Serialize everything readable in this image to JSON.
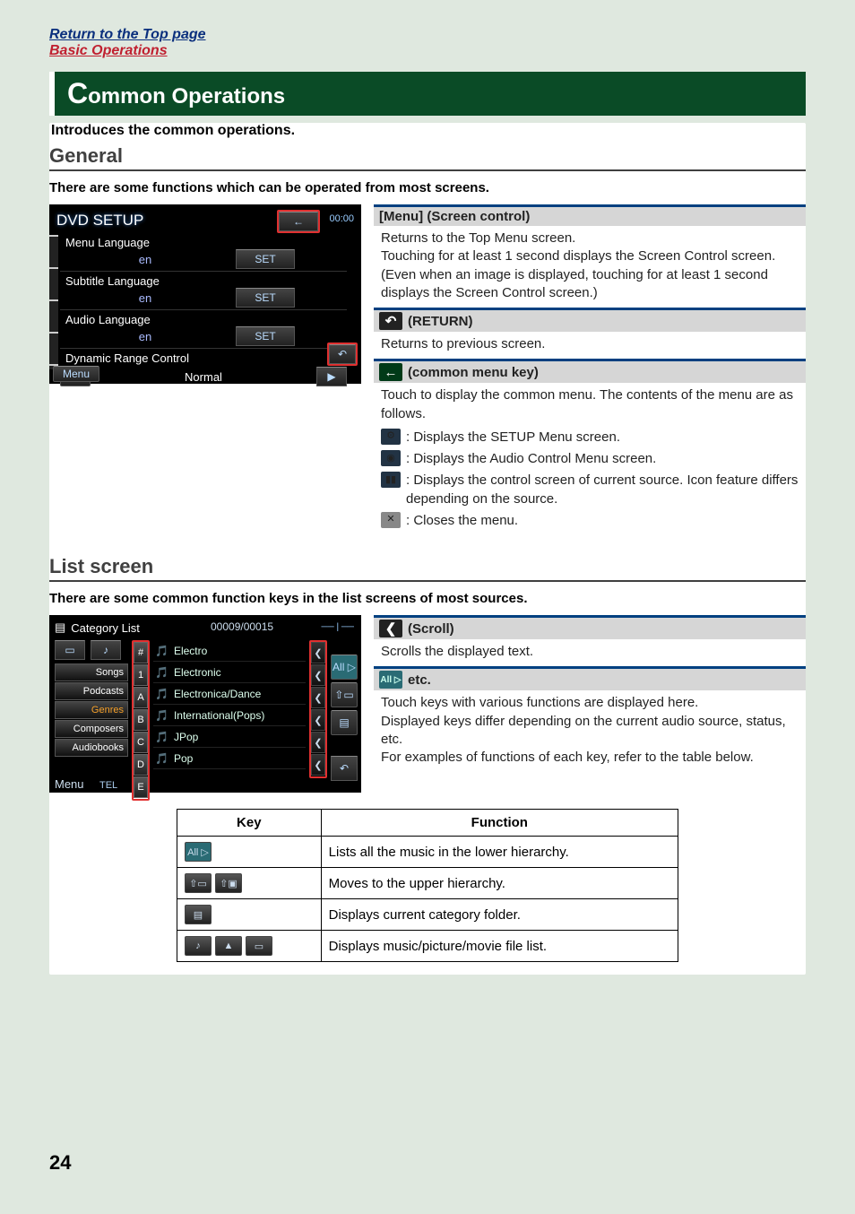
{
  "top_links": {
    "return": "Return to the Top page",
    "basic": "Basic Operations"
  },
  "title_prefix": "C",
  "title_rest": "ommon Operations",
  "intro": "Introduces the common operations.",
  "general": {
    "heading": "General",
    "sub": "There are some functions which can be operated from most screens."
  },
  "dvd": {
    "title": "DVD SETUP",
    "time": "00:00",
    "rows": [
      {
        "label": "Menu Language",
        "value": "en",
        "btn": "SET"
      },
      {
        "label": "Subtitle Language",
        "value": "en",
        "btn": "SET"
      },
      {
        "label": "Audio Language",
        "value": "en",
        "btn": "SET"
      }
    ],
    "range_label": "Dynamic Range Control",
    "range_value": "Normal",
    "menu_btn": "Menu"
  },
  "explain_general": {
    "h1": "[Menu] (Screen control)",
    "p1": "Returns to the Top Menu screen.\nTouching for at least 1 second displays the Screen Control screen. (Even when an image is displayed, touching for at least 1 second displays the Screen Control screen.)",
    "h2": "(RETURN)",
    "p2": "Returns to previous screen.",
    "h3": "(common menu key)",
    "p3": "Touch to display the common menu. The contents of the menu are as follows.",
    "bullets": [
      ": Displays the SETUP Menu screen.",
      ": Displays the Audio Control Menu screen.",
      ": Displays the control screen of current source. Icon feature differs depending on the source.",
      ": Closes the menu."
    ]
  },
  "list": {
    "heading": "List screen",
    "sub": "There are some common function keys in the list screens of most sources."
  },
  "cat": {
    "title": "Category List",
    "count": "00009/00015",
    "tabs": [
      "Songs",
      "Podcasts",
      "Genres",
      "Composers",
      "Audiobooks"
    ],
    "alpha": [
      "#",
      "1",
      "A",
      "B",
      "C",
      "D",
      "E"
    ],
    "rows": [
      "Electro",
      "Electronic",
      "Electronica/Dance",
      "International(Pops)",
      "JPop",
      "Pop"
    ],
    "all_label": "All ▷",
    "menu": "Menu",
    "tel": "TEL"
  },
  "explain_list": {
    "h1": "(Scroll)",
    "p1": "Scrolls the displayed text.",
    "h2_label": "All ▷",
    "h2": "etc.",
    "p2": "Touch keys with various functions are displayed here.\nDisplayed keys differ depending on the current audio source, status, etc.\nFor examples of functions of each key, refer to the table below."
  },
  "table": {
    "head_key": "Key",
    "head_func": "Function",
    "rows": [
      {
        "key_icons": [
          "All ▷"
        ],
        "func": "Lists all the music in the lower hierarchy."
      },
      {
        "key_icons": [
          "⇧▭",
          "⇧▣"
        ],
        "func": "Moves to the upper hierarchy."
      },
      {
        "key_icons": [
          "▤"
        ],
        "func": "Displays current category folder."
      },
      {
        "key_icons": [
          "♪",
          "▲",
          "▭"
        ],
        "func": "Displays music/picture/movie file list."
      }
    ]
  },
  "page_number": "24"
}
